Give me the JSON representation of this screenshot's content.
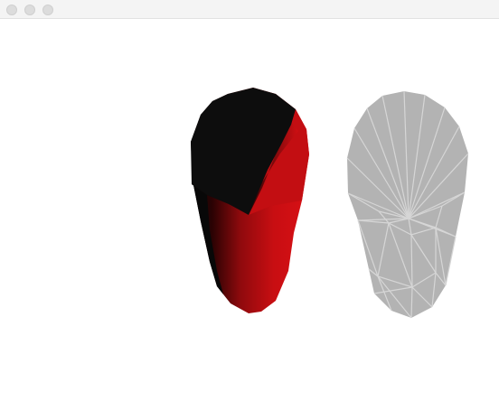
{
  "window": {
    "title": "",
    "controls": [
      "close-button",
      "minimize-button",
      "zoom-button"
    ]
  },
  "scene": {
    "background": "#ffffff",
    "models": [
      {
        "name": "shaded-capsule",
        "render_mode": "solid",
        "colors": {
          "dark": "#0d0d0d",
          "light": "#d40f13",
          "mid": "#b60c10",
          "deep": "#5a0508"
        }
      },
      {
        "name": "wireframe-capsule",
        "render_mode": "wireframe",
        "colors": {
          "fill": "#b3b3b3",
          "edge": "#d6d6d6"
        }
      }
    ]
  }
}
